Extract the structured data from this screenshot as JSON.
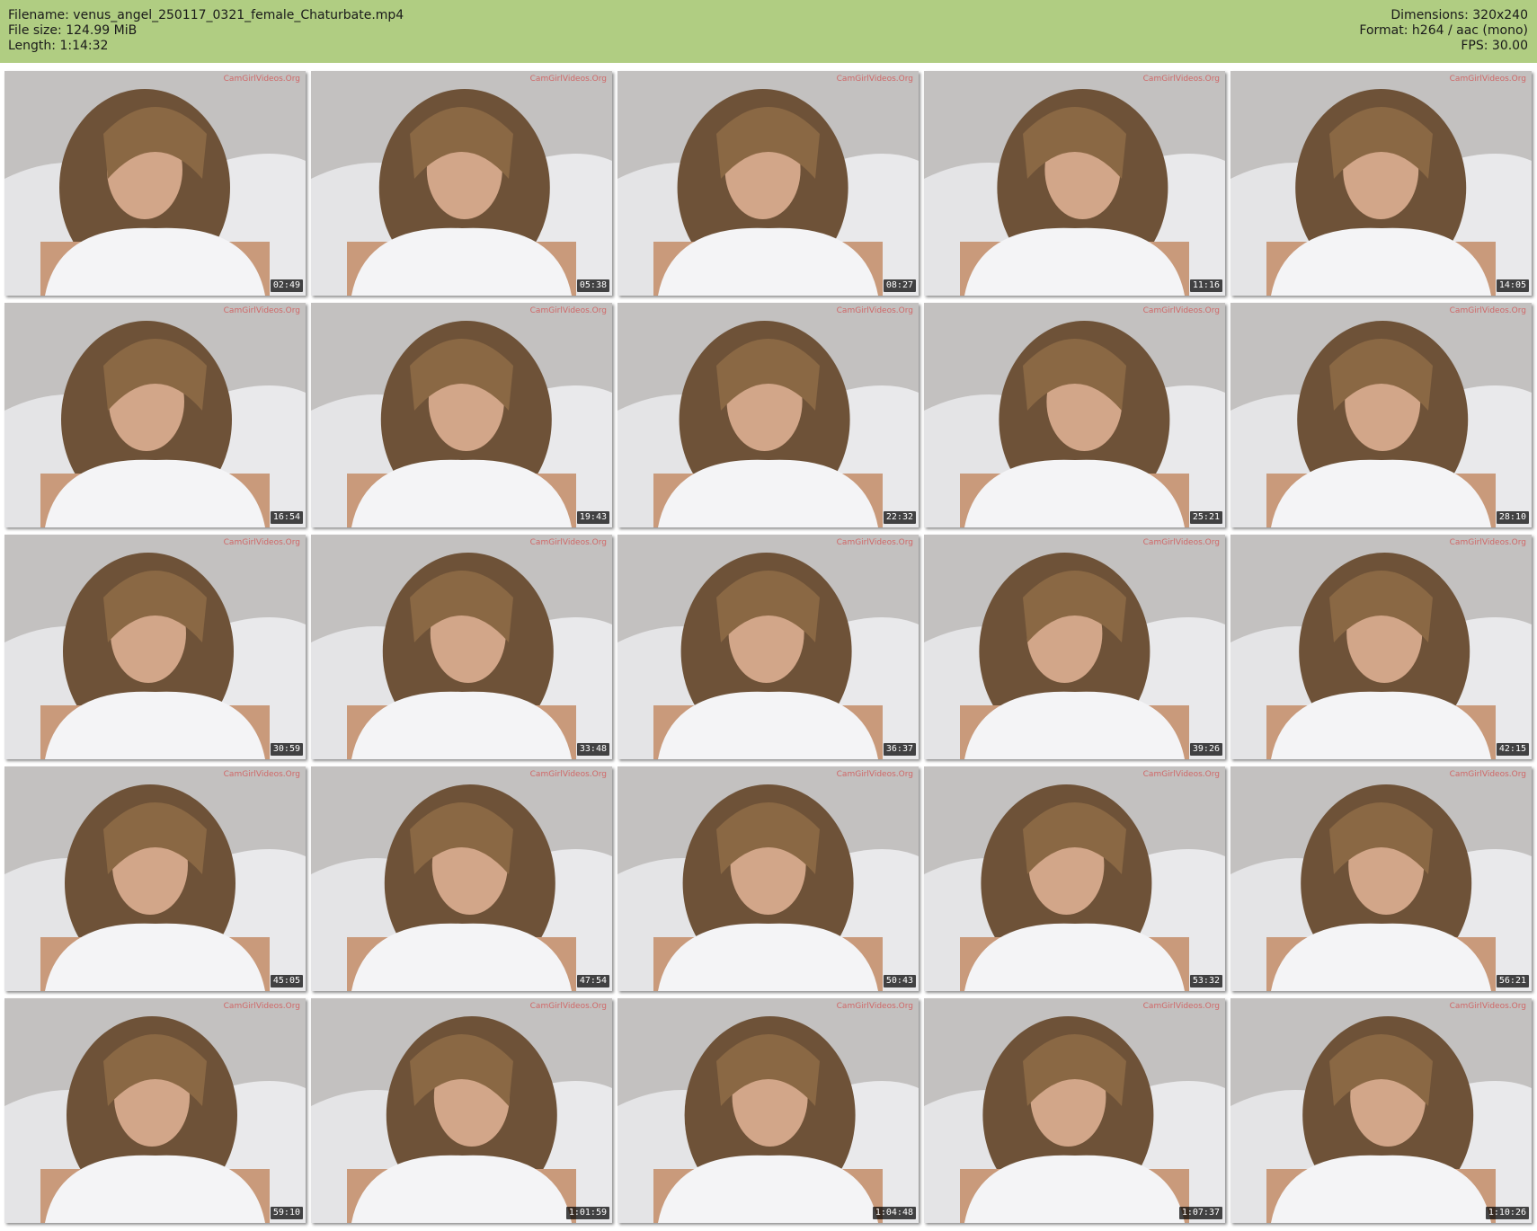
{
  "header": {
    "filename_label": "Filename: venus_angel_250117_0321_female_Chaturbate.mp4",
    "filesize_label": "File size: 124.99 MiB",
    "length_label": "Length: 1:14:32",
    "dimensions_label": "Dimensions: 320x240",
    "format_label": "Format: h264 / aac (mono)",
    "fps_label": "FPS: 30.00"
  },
  "colors": {
    "header_bg": "#b0cd82",
    "timestamp_bg": "#000000",
    "watermark": "#d44a4a"
  },
  "watermark_text": "CamGirlVideos.Org",
  "thumbnails": [
    {
      "time": "02:49"
    },
    {
      "time": "05:38"
    },
    {
      "time": "08:27"
    },
    {
      "time": "11:16"
    },
    {
      "time": "14:05"
    },
    {
      "time": "16:54"
    },
    {
      "time": "19:43"
    },
    {
      "time": "22:32"
    },
    {
      "time": "25:21"
    },
    {
      "time": "28:10"
    },
    {
      "time": "30:59"
    },
    {
      "time": "33:48"
    },
    {
      "time": "36:37"
    },
    {
      "time": "39:26"
    },
    {
      "time": "42:15"
    },
    {
      "time": "45:05"
    },
    {
      "time": "47:54"
    },
    {
      "time": "50:43"
    },
    {
      "time": "53:32"
    },
    {
      "time": "56:21"
    },
    {
      "time": "59:10"
    },
    {
      "time": "1:01:59"
    },
    {
      "time": "1:04:48"
    },
    {
      "time": "1:07:37"
    },
    {
      "time": "1:10:26"
    }
  ]
}
